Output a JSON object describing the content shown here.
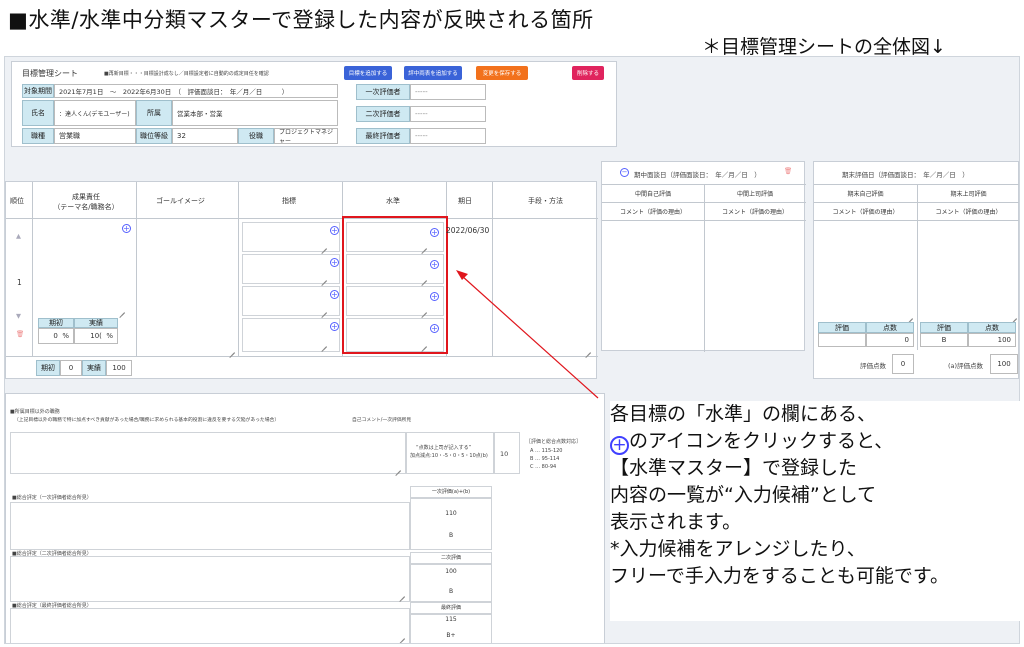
{
  "heading": "■水準/水準中分類マスターで登録した内容が反映される箇所",
  "subheading": "＊目標管理シートの全体図↓",
  "sheet": {
    "title": "目標管理シート",
    "note": "■再新目標・・・目標設計成なし／目標設定者に自動的の成定目任を確認",
    "buttons": {
      "add_goal": "目標を追加する",
      "add_category": "評中両表を追加する",
      "save": "変更を保存する",
      "delete": "削除する"
    },
    "colors": {
      "blue": "#3a63d8",
      "orange": "#f2711c",
      "red": "#e0245e",
      "label": "#cfe9f2"
    }
  },
  "info": {
    "period_label": "対象期間",
    "period_value": "2021年7月1日　〜　2022年6月30日　（　評価面談日：　年／月／日　　　）",
    "name_label": "氏名",
    "name_value": "：達人くん(デモユーザー)",
    "dept_label": "所属",
    "dept_value": "営業本部・営業",
    "job_label": "職種",
    "job_value": "営業職",
    "grade_label": "職位等級",
    "grade_value": "32",
    "role_label": "役職",
    "role_value": "プロジェクトマネジャー",
    "eval1_label": "一次評価者",
    "eval2_label": "二次評価者",
    "final_label": "最終評価者",
    "eval_placeholder": "-----"
  },
  "goal_table": {
    "headers": {
      "rank": "順位",
      "responsibility": "成果責任\n（テーマ名/職務名）",
      "goal_image": "ゴールイメージ",
      "indicator": "指標",
      "level": "水準",
      "deadline": "期日",
      "method": "手段・方法"
    },
    "rank_value": "1",
    "deadline_value": "2022/06/30",
    "plan_label": "期初",
    "actual_label": "実績",
    "plan_value": "0",
    "actual_value": "10(",
    "percent": "%",
    "footer_plan_label": "期初",
    "footer_plan_value": "0",
    "footer_actual_label": "実績",
    "footer_actual_value": "100"
  },
  "mid_review": {
    "title": "期中面談日（評価面談日：　年／月／日　）",
    "self_label": "中間自己評価",
    "boss_label": "中間上司評価",
    "comment1": "コメント（評価の理由）",
    "comment2": "コメント（評価の理由）"
  },
  "end_review": {
    "title": "期末評価日（評価面談日：　年／月／日　）",
    "self_label": "期末自己評価",
    "boss_label": "期末上司評価",
    "comment1": "コメント（評価の理由）",
    "comment2": "コメント（評価の理由）",
    "score_label1": "評価",
    "point_label1": "点数",
    "score_value1": "",
    "point_value1": "0",
    "score_label2": "評価",
    "point_label2": "点数",
    "score_value2": "B",
    "point_value2": "100",
    "total_label1": "評価点数",
    "total_value1": "0",
    "total_label2": "(a)評価点数",
    "total_value2": "100"
  },
  "bottom": {
    "outside_title": "■所属目標以外の職務",
    "outside_note": "（上記目標以外の職務で特に加点すべき貢献があった場合/職務に求められる基本的役割に違反を要する欠陥があった場合）",
    "self_comment": "自己コメント/一次評価所見",
    "points_note1": "“点数は上司が記入する”",
    "points_note2": "加点減点:10・-5・0・5・10点(b)",
    "points_value": "10",
    "legend_title": "［評価と総合点数対応］",
    "legend_a": "A … 115-120",
    "legend_b": "B … 95-114",
    "legend_c": "C … 80-94",
    "overall1_label": "■総合評定（一次評価者総合所見）",
    "overall1_head": "一次評価(a)+(b)",
    "overall1_score": "110",
    "overall1_grade": "B",
    "overall2_label": "■総合評定（二次評価者総合所見）",
    "overall2_head": "二次評価",
    "overall2_score": "100",
    "overall2_grade": "B",
    "overall3_label": "■総合評定（最終評価者総合所見）",
    "overall3_head": "最終評価",
    "overall3_score": "115",
    "overall3_grade": "B+"
  },
  "annotation": {
    "line1": "各目標の「水準」の欄にある、",
    "line2": "のアイコンをクリックすると、",
    "line3": "【水準マスター】で登録した",
    "line4": "内容の一覧が“入力候補”として",
    "line5": "表示されます。",
    "line6": "*入力候補をアレンジしたり、",
    "line7": "フリーで手入力をすることも可能です。"
  }
}
